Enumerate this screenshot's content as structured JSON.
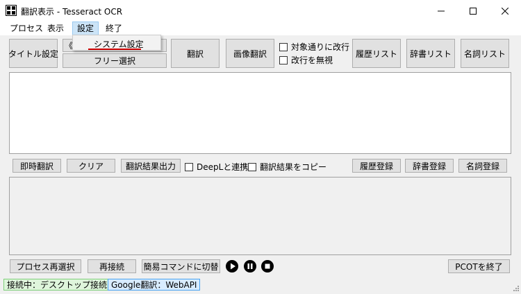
{
  "window": {
    "title": "翻訳表示 - Tesseract OCR"
  },
  "menu": {
    "items": [
      "プロセス",
      "表示",
      "設定",
      "終了"
    ],
    "dropdown_item": "システム設定"
  },
  "toolbar": {
    "title_setting": "タイトル設定",
    "hidden_partial": "《",
    "free_select": "フリー選択",
    "translate": "翻訳",
    "image_translate": "画像翻訳",
    "check_target_newline": "対象通りに改行",
    "check_ignore_newline": "改行を無視",
    "history_list": "履歴リスト",
    "dict_list": "辞書リスト",
    "noun_list": "名詞リスト"
  },
  "mid": {
    "instant": "即時翻訳",
    "clear": "クリア",
    "output": "翻訳結果出力",
    "deepl": "DeepLと連携",
    "copy": "翻訳結果をコピー",
    "history_reg": "履歴登録",
    "dict_reg": "辞書登録",
    "noun_reg": "名詞登録"
  },
  "bottom": {
    "reselect": "プロセス再選択",
    "reconnect": "再接続",
    "simple_cmd": "簡易コマンドに切替",
    "quit": "PCOTを終了"
  },
  "status": {
    "connection": "接続中：デスクトップ接続",
    "engine": "Google翻訳：WebAPI"
  },
  "colors": {
    "status_green_bg": "#dff5dc",
    "status_green_border": "#7fcf7a",
    "status_blue_bg": "#d8ecff",
    "status_blue_border": "#4aa3f0",
    "accent_underline": "#cc0000"
  }
}
